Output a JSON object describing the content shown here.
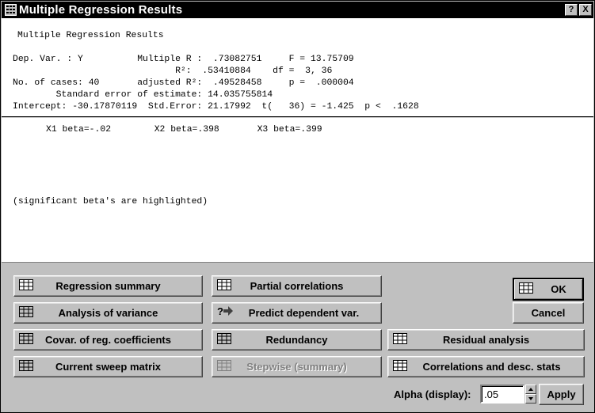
{
  "window": {
    "title": "Multiple Regression Results",
    "help_label": "?",
    "close_label": "X"
  },
  "summary": {
    "heading": "Multiple Regression Results",
    "lines": [
      "Dep. Var. : Y          Multiple R :  .73082751     F = 13.75709",
      "                              R²:  .53410884    df =  3, 36",
      "No. of cases: 40       adjusted R²:  .49528458     p =  .000004",
      "        Standard error of estimate: 14.035755814",
      "Intercept: -30.17870119  Std.Error: 21.17992  t(   36) = -1.425  p <  .1628"
    ]
  },
  "betas": {
    "line": "X1 beta=-.02        X2 beta=.398       X3 beta=.399",
    "note": "(significant beta's are highlighted)"
  },
  "buttons": {
    "regression_summary": "Regression summary",
    "partial_correlations": "Partial correlations",
    "analysis_of_variance": "Analysis of variance",
    "predict_dependent": "Predict dependent var.",
    "covar_coefficients": "Covar. of reg. coefficients",
    "redundancy": "Redundancy",
    "residual_analysis": "Residual analysis",
    "current_sweep_matrix": "Current sweep matrix",
    "stepwise_summary": "Stepwise (summary)",
    "correlations_desc": "Correlations and desc. stats",
    "ok": "OK",
    "cancel": "Cancel",
    "apply": "Apply"
  },
  "alpha": {
    "label": "Alpha (display):",
    "value": ".05"
  },
  "icons": {
    "predict": "?"
  }
}
